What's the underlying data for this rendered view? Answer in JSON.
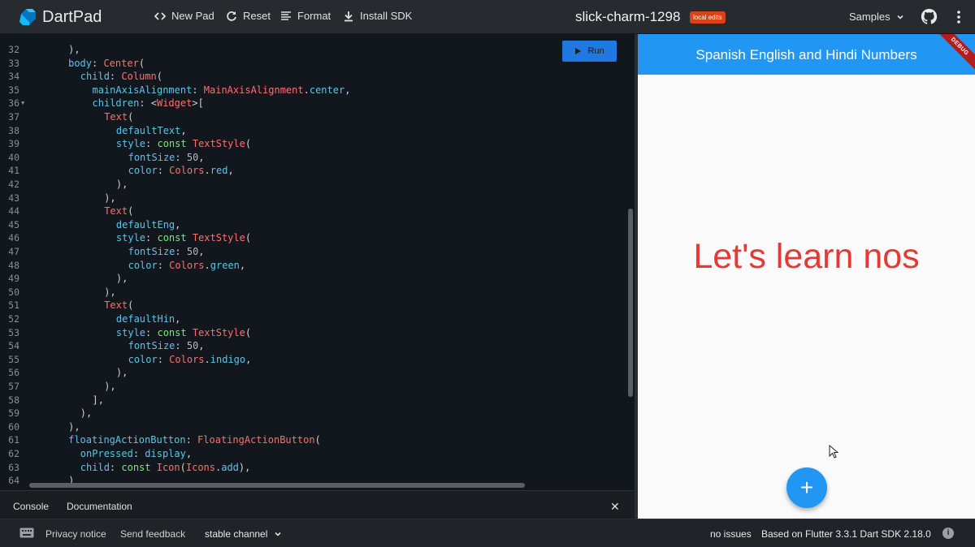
{
  "topbar": {
    "brand": "DartPad",
    "new_pad": "New Pad",
    "reset": "Reset",
    "format": "Format",
    "install_sdk": "Install SDK",
    "pad_name": "slick-charm-1298",
    "badge": "local edits",
    "samples": "Samples"
  },
  "editor": {
    "run_label": "Run",
    "lines": [
      {
        "n": "32",
        "indent": 6,
        "tokens": [
          [
            "punc",
            "),"
          ]
        ]
      },
      {
        "n": "33",
        "indent": 6,
        "tokens": [
          [
            "prop",
            "body"
          ],
          [
            "punc",
            ": "
          ],
          [
            "cls",
            "Center"
          ],
          [
            "punc",
            "("
          ]
        ]
      },
      {
        "n": "34",
        "indent": 8,
        "tokens": [
          [
            "prop",
            "child"
          ],
          [
            "punc",
            ": "
          ],
          [
            "cls",
            "Column"
          ],
          [
            "punc",
            "("
          ]
        ]
      },
      {
        "n": "35",
        "indent": 10,
        "tokens": [
          [
            "prop",
            "mainAxisAlignment"
          ],
          [
            "punc",
            ": "
          ],
          [
            "cls",
            "MainAxisAlignment"
          ],
          [
            "punc",
            "."
          ],
          [
            "prop",
            "center"
          ],
          [
            "punc",
            ","
          ]
        ]
      },
      {
        "n": "36",
        "indent": 10,
        "fold": true,
        "tokens": [
          [
            "prop",
            "children"
          ],
          [
            "punc",
            ": <"
          ],
          [
            "cls",
            "Widget"
          ],
          [
            "punc",
            ">["
          ]
        ]
      },
      {
        "n": "37",
        "indent": 12,
        "tokens": [
          [
            "cls",
            "Text"
          ],
          [
            "punc",
            "("
          ]
        ]
      },
      {
        "n": "38",
        "indent": 14,
        "tokens": [
          [
            "prop",
            "defaultText"
          ],
          [
            "punc",
            ","
          ]
        ]
      },
      {
        "n": "39",
        "indent": 14,
        "tokens": [
          [
            "prop",
            "style"
          ],
          [
            "punc",
            ": "
          ],
          [
            "kw",
            "const "
          ],
          [
            "cls",
            "TextStyle"
          ],
          [
            "punc",
            "("
          ]
        ]
      },
      {
        "n": "40",
        "indent": 16,
        "tokens": [
          [
            "prop",
            "fontSize"
          ],
          [
            "punc",
            ": "
          ],
          [
            "num",
            "50"
          ],
          [
            "punc",
            ","
          ]
        ]
      },
      {
        "n": "41",
        "indent": 16,
        "tokens": [
          [
            "prop",
            "color"
          ],
          [
            "punc",
            ": "
          ],
          [
            "cls",
            "Colors"
          ],
          [
            "punc",
            "."
          ],
          [
            "prop",
            "red"
          ],
          [
            "punc",
            ","
          ]
        ]
      },
      {
        "n": "42",
        "indent": 14,
        "tokens": [
          [
            "punc",
            "),"
          ]
        ]
      },
      {
        "n": "43",
        "indent": 12,
        "tokens": [
          [
            "punc",
            "),"
          ]
        ]
      },
      {
        "n": "44",
        "indent": 12,
        "tokens": [
          [
            "cls",
            "Text"
          ],
          [
            "punc",
            "("
          ]
        ]
      },
      {
        "n": "45",
        "indent": 14,
        "tokens": [
          [
            "prop",
            "defaultEng"
          ],
          [
            "punc",
            ","
          ]
        ]
      },
      {
        "n": "46",
        "indent": 14,
        "tokens": [
          [
            "prop",
            "style"
          ],
          [
            "punc",
            ": "
          ],
          [
            "kw",
            "const "
          ],
          [
            "cls",
            "TextStyle"
          ],
          [
            "punc",
            "("
          ]
        ]
      },
      {
        "n": "47",
        "indent": 16,
        "tokens": [
          [
            "prop",
            "fontSize"
          ],
          [
            "punc",
            ": "
          ],
          [
            "num",
            "50"
          ],
          [
            "punc",
            ","
          ]
        ]
      },
      {
        "n": "48",
        "indent": 16,
        "tokens": [
          [
            "prop",
            "color"
          ],
          [
            "punc",
            ": "
          ],
          [
            "cls",
            "Colors"
          ],
          [
            "punc",
            "."
          ],
          [
            "prop",
            "green"
          ],
          [
            "punc",
            ","
          ]
        ]
      },
      {
        "n": "49",
        "indent": 14,
        "tokens": [
          [
            "punc",
            "),"
          ]
        ]
      },
      {
        "n": "50",
        "indent": 12,
        "tokens": [
          [
            "punc",
            "),"
          ]
        ]
      },
      {
        "n": "51",
        "indent": 12,
        "tokens": [
          [
            "cls",
            "Text"
          ],
          [
            "punc",
            "("
          ]
        ]
      },
      {
        "n": "52",
        "indent": 14,
        "tokens": [
          [
            "prop",
            "defaultHin"
          ],
          [
            "punc",
            ","
          ]
        ]
      },
      {
        "n": "53",
        "indent": 14,
        "tokens": [
          [
            "prop",
            "style"
          ],
          [
            "punc",
            ": "
          ],
          [
            "kw",
            "const "
          ],
          [
            "cls",
            "TextStyle"
          ],
          [
            "punc",
            "("
          ]
        ]
      },
      {
        "n": "54",
        "indent": 16,
        "tokens": [
          [
            "prop",
            "fontSize"
          ],
          [
            "punc",
            ": "
          ],
          [
            "num",
            "50"
          ],
          [
            "punc",
            ","
          ]
        ]
      },
      {
        "n": "55",
        "indent": 16,
        "tokens": [
          [
            "prop",
            "color"
          ],
          [
            "punc",
            ": "
          ],
          [
            "cls",
            "Colors"
          ],
          [
            "punc",
            "."
          ],
          [
            "prop",
            "indigo"
          ],
          [
            "punc",
            ","
          ]
        ]
      },
      {
        "n": "56",
        "indent": 14,
        "tokens": [
          [
            "punc",
            "),"
          ]
        ]
      },
      {
        "n": "57",
        "indent": 12,
        "tokens": [
          [
            "punc",
            "),"
          ]
        ]
      },
      {
        "n": "58",
        "indent": 10,
        "tokens": [
          [
            "punc",
            "],"
          ]
        ]
      },
      {
        "n": "59",
        "indent": 8,
        "tokens": [
          [
            "punc",
            "),"
          ]
        ]
      },
      {
        "n": "60",
        "indent": 6,
        "tokens": [
          [
            "punc",
            "),"
          ]
        ]
      },
      {
        "n": "61",
        "indent": 6,
        "tokens": [
          [
            "prop",
            "floatingActionButton"
          ],
          [
            "punc",
            ": "
          ],
          [
            "cls",
            "FloatingActionButton"
          ],
          [
            "punc",
            "("
          ]
        ]
      },
      {
        "n": "62",
        "indent": 8,
        "tokens": [
          [
            "prop",
            "onPressed"
          ],
          [
            "punc",
            ": "
          ],
          [
            "prop",
            "display"
          ],
          [
            "punc",
            ","
          ]
        ]
      },
      {
        "n": "63",
        "indent": 8,
        "tokens": [
          [
            "prop",
            "child"
          ],
          [
            "punc",
            ": "
          ],
          [
            "kw",
            "const "
          ],
          [
            "cls",
            "Icon"
          ],
          [
            "punc",
            "("
          ],
          [
            "cls",
            "Icons"
          ],
          [
            "punc",
            "."
          ],
          [
            "prop",
            "add"
          ],
          [
            "punc",
            "),"
          ]
        ]
      },
      {
        "n": "64",
        "indent": 6,
        "tokens": [
          [
            "punc",
            ")"
          ]
        ]
      }
    ]
  },
  "console": {
    "tab_console": "Console",
    "tab_docs": "Documentation",
    "close": "✕"
  },
  "preview": {
    "appbar_title": "Spanish English and Hindi Numbers",
    "debug_banner": "DEBUG",
    "center_text": "Let's learn nos",
    "fab_icon": "+"
  },
  "statusbar": {
    "privacy": "Privacy notice",
    "feedback": "Send feedback",
    "channel": "stable channel",
    "issues": "no issues",
    "version": "Based on Flutter 3.3.1 Dart SDK 2.18.0"
  },
  "colors": {
    "accent": "#2196f3",
    "badge": "#d84315",
    "text_red": "#e53935"
  }
}
